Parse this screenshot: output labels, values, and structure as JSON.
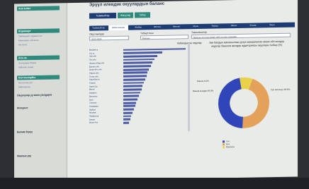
{
  "sidebar": {
    "header": "Axa ketter",
    "groups": [
      {
        "header": "Boрамарт",
        "items": [
          "Тайбамыйт тадкмлетик",
          "Maaлымат ыйлагын",
          "Ыy кошу"
        ]
      },
      {
        "header": "Ата-на",
        "items": [
          "Атагандын баары",
          "Кийинки талар"
        ]
      },
      {
        "header": "Kаттоолорбы",
        "items": [
          "Катталган уул",
          "Кийинкилер"
        ]
      }
    ],
    "dark_items": [
      "Окуучулар уу жана уюлдарга",
      "Интернэт",
      "Билим берүү",
      "Жаалык уку"
    ]
  },
  "main": {
    "title": "Эрүүл илевдик окуулардын баланс",
    "page_tabs": [
      "Тывамыйтар",
      "Жагүүлөр",
      "Табар"
    ],
    "sub_tabs": [
      "Тывамыйтар",
      "Кайылымдар",
      "Жибер",
      "ОБ Ост",
      "Мектеп",
      "Муха",
      "Тамыр",
      "Ийгил",
      "Жасар",
      "Бири"
    ],
    "active_sub_tab": 1,
    "filters": [
      {
        "label": "Окуу жылдар",
        "value": "2023-2024"
      },
      {
        "label": "Тибыртлыш",
        "value": "Бардык"
      },
      {
        "label": "Тышылыштар",
        "value": "Бардык окуулар жана лабк куулар чиршиби"
      }
    ],
    "bar_panel_label": "Кабылдыгыш окуулар"
  },
  "chart_data": [
    {
      "type": "bar",
      "orientation": "horizontal",
      "title": "Кабылдыгыш окуулар",
      "categories": [
        "Бишкек ш.",
        "Ош ш.",
        "Чүй обл.",
        "Ош обл.",
        "Жалал-Абад обл.",
        "Баткен обл.",
        "Ысык-Көл обл.",
        "Нарын обл.",
        "Талас обл.",
        "Кара-Балта",
        "Токмок",
        "Кара-Суу",
        "Өзгөн",
        "Каракол",
        "Балыкчы",
        "Кант",
        "Сокулук",
        "Аламүдүн",
        "Жайыл",
        "Москва",
        "Панфилов",
        "Кемин",
        "Ысык-Ата"
      ],
      "values": [
        100,
        62,
        55,
        50,
        47,
        44,
        41,
        39,
        37,
        35,
        33,
        31,
        29,
        27,
        25,
        23,
        21,
        19,
        17,
        15,
        13,
        11,
        9
      ],
      "xlim": [
        0,
        100
      ]
    },
    {
      "type": "pie",
      "title": "Эки балдын жанашылыш уулун жанааланган аккан обл жолдор окуулар башкага жылдар аудиториясы окуулары тыбыр (%)",
      "categories": [
        "Кыз",
        "Уул",
        "Башкасы"
      ],
      "values": [
        45.3,
        46.5,
        8.2
      ],
      "labels": [
        "Башка кыздар 45.3%",
        "Уул катышуу 46.5%",
        "Башка 8.2%"
      ],
      "colors": [
        "#e3a15a",
        "#2f45b8",
        "#e8d24a"
      ],
      "hole": 0.55
    }
  ]
}
